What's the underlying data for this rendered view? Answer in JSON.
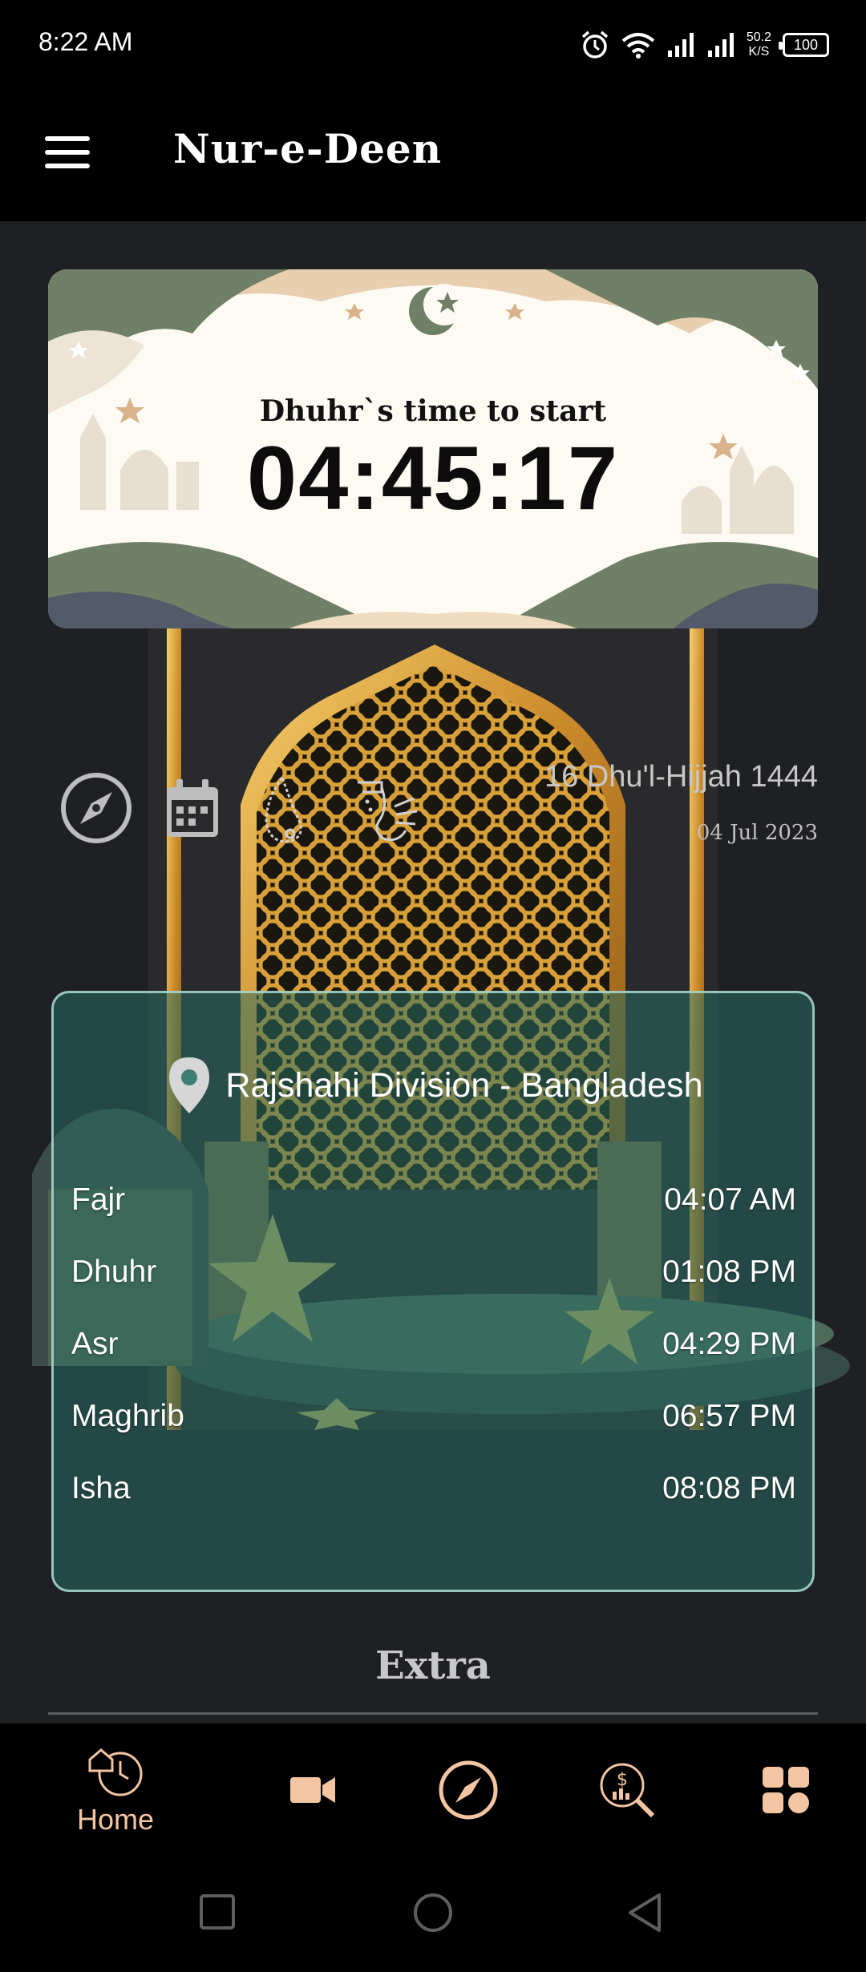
{
  "status_bar": {
    "time": "8:22 AM",
    "net_speed_value": "50.2",
    "net_speed_unit": "K/S",
    "battery": "100",
    "icons": [
      "alarm-icon",
      "wifi-icon",
      "signal-icon",
      "signal-icon"
    ]
  },
  "app_bar": {
    "title": "Nur-e-Deen",
    "menu_icon": "hamburger-menu-icon"
  },
  "banner": {
    "label": "Dhuhr`s time to start",
    "countdown": "04:45:17"
  },
  "quick_icons": [
    "compass-icon",
    "calendar-icon",
    "tasbih-icon",
    "wudu-icon"
  ],
  "dates": {
    "hijri": "16 Dhu'l-Hijjah 1444",
    "gregorian": "04 Jul 2023"
  },
  "prayer_card": {
    "location": "Rajshahi Division - Bangladesh",
    "prayers": [
      {
        "name": "Fajr",
        "time": "04:07 AM"
      },
      {
        "name": "Dhuhr",
        "time": "01:08 PM"
      },
      {
        "name": "Asr",
        "time": "04:29 PM"
      },
      {
        "name": "Maghrib",
        "time": "06:57 PM"
      },
      {
        "name": "Isha",
        "time": "08:08 PM"
      }
    ]
  },
  "extra": {
    "title": "Extra"
  },
  "bottom_nav": {
    "items": [
      {
        "label": "Home",
        "icon": "clock-home-icon",
        "active": true
      },
      {
        "label": "",
        "icon": "video-icon"
      },
      {
        "label": "",
        "icon": "compass-icon"
      },
      {
        "label": "",
        "icon": "finance-search-icon"
      },
      {
        "label": "",
        "icon": "grid-apps-icon"
      }
    ]
  },
  "colors": {
    "accent": "#f4c5a3",
    "card": "#2f7a6e",
    "background": "#1f2024"
  }
}
